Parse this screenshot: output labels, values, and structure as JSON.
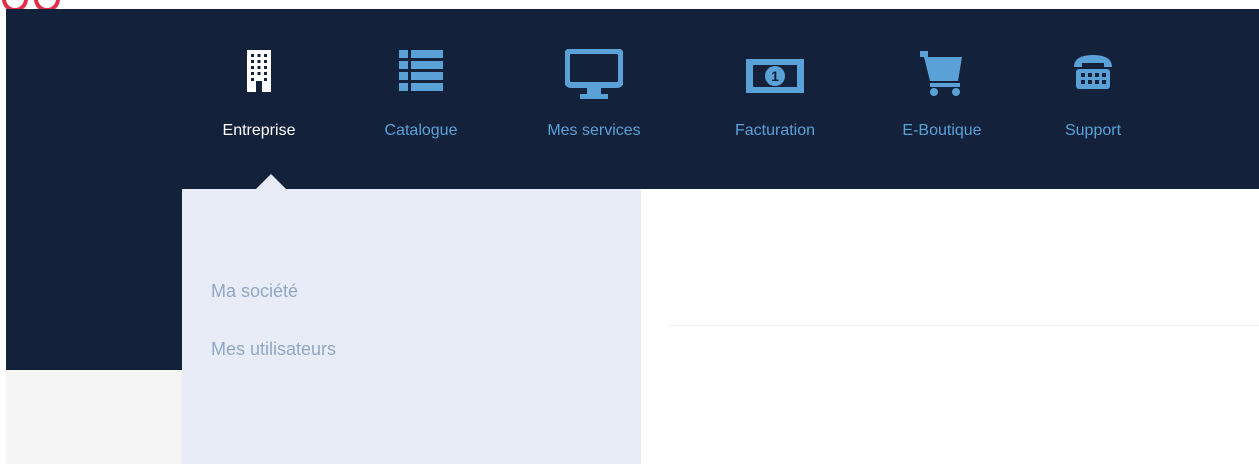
{
  "nav": {
    "items": [
      {
        "label": "Entreprise",
        "icon": "building-icon",
        "active": true
      },
      {
        "label": "Catalogue",
        "icon": "list-icon",
        "active": false
      },
      {
        "label": "Mes services",
        "icon": "monitor-icon",
        "active": false
      },
      {
        "label": "Facturation",
        "icon": "banknote-icon",
        "active": false
      },
      {
        "label": "E-Boutique",
        "icon": "shopping-cart-icon",
        "active": false
      },
      {
        "label": "Support",
        "icon": "telephone-icon",
        "active": false
      }
    ]
  },
  "dropdown": {
    "items": [
      {
        "label": "Ma société"
      },
      {
        "label": "Mes utilisateurs"
      }
    ]
  },
  "colors": {
    "navbar_bg": "#14213a",
    "accent_blue": "#5aa1d8",
    "active_text": "#ffffff",
    "dropdown_bg": "#e8ecf6",
    "dropdown_text": "#8fa7c5",
    "logo_red": "#e2304a"
  }
}
